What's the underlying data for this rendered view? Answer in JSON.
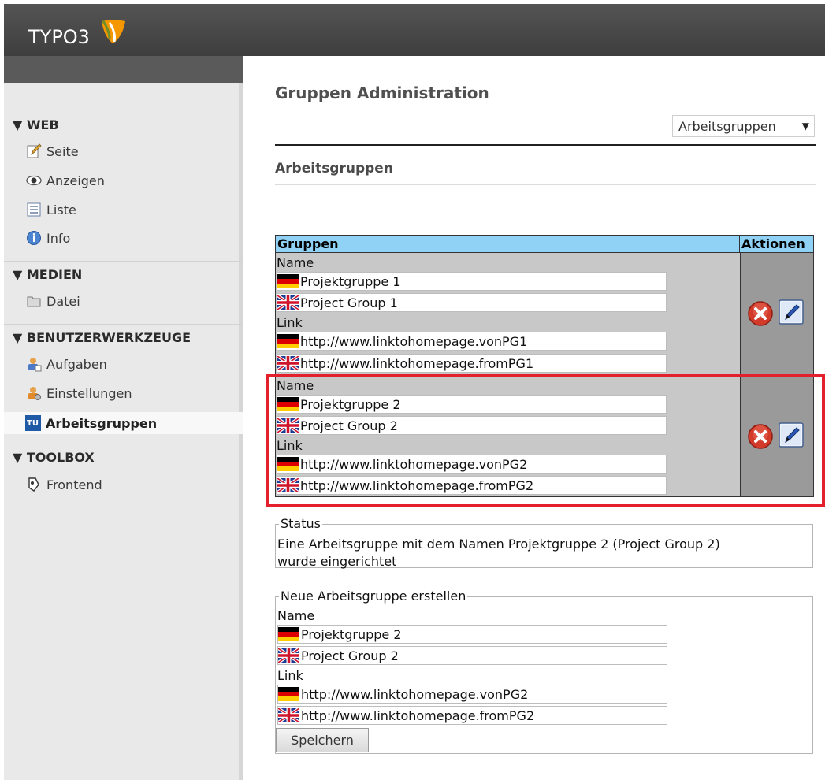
{
  "app": {
    "logo_text": "TYPO3"
  },
  "sidebar": {
    "sections": {
      "web": "▼ WEB",
      "medien": "▼ MEDIEN",
      "benutzer": "▼ BENUTZERWERKZEUGE",
      "toolbox": "▼ TOOLBOX"
    },
    "items": {
      "seite": "Seite",
      "anzeigen": "Anzeigen",
      "liste": "Liste",
      "info": "Info",
      "datei": "Datei",
      "aufgaben": "Aufgaben",
      "einstellungen": "Einstellungen",
      "arbeitsgruppen": "Arbeitsgruppen",
      "frontend": "Frontend"
    }
  },
  "main": {
    "title": "Gruppen Administration",
    "select_value": "Arbeitsgruppen",
    "subtitle": "Arbeitsgruppen"
  },
  "table": {
    "col_groups": "Gruppen",
    "col_actions": "Aktionen",
    "name_label": "Name",
    "link_label": "Link",
    "rows": [
      {
        "name_de": "Projektgruppe 1",
        "name_en": "Project Group 1",
        "link_de": "http://www.linktohomepage.vonPG1",
        "link_en": "http://www.linktohomepage.fromPG1"
      },
      {
        "name_de": "Projektgruppe 2",
        "name_en": "Project Group 2",
        "link_de": "http://www.linktohomepage.vonPG2",
        "link_en": "http://www.linktohomepage.fromPG2"
      }
    ]
  },
  "status": {
    "legend": "Status",
    "line1": "Eine Arbeitsgruppe mit dem Namen Projektgruppe 2 (Project Group 2)",
    "line2": "wurde eingerichtet"
  },
  "new_group": {
    "legend": "Neue Arbeitsgruppe erstellen",
    "name_label": "Name",
    "link_label": "Link",
    "name_de": "Projektgruppe 2",
    "name_en": "Project Group 2",
    "link_de": "http://www.linktohomepage.vonPG2",
    "link_en": "http://www.linktohomepage.fromPG2",
    "save_label": "Speichern"
  },
  "colors": {
    "header_blue": "#8fd2f5",
    "highlight_red": "#e5202d",
    "topbar": "#4a4a4a"
  }
}
